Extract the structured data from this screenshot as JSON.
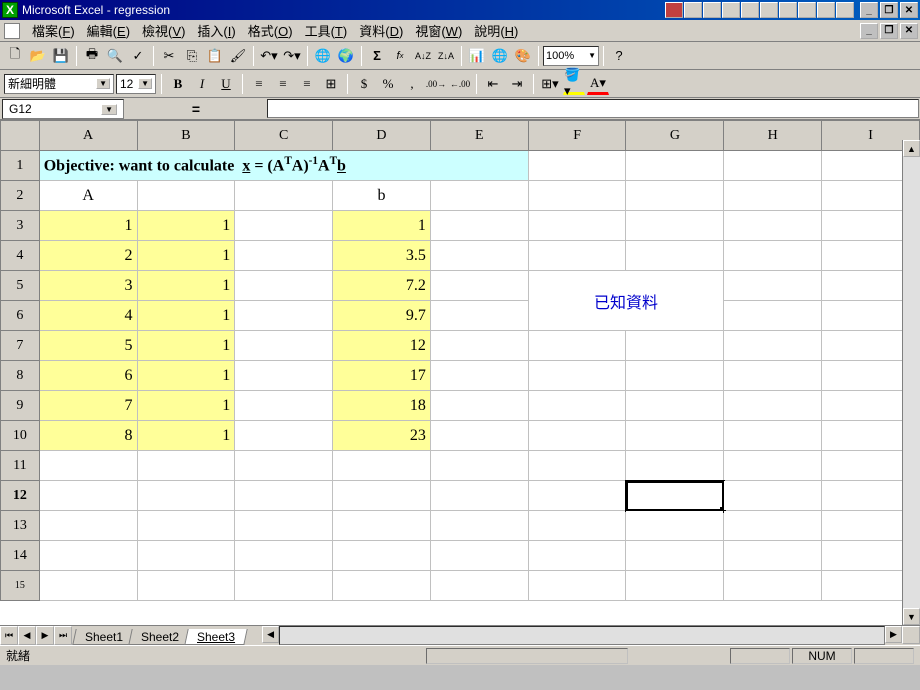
{
  "titlebar": {
    "app_name": "Microsoft Excel",
    "doc_name": "regression"
  },
  "menubar": {
    "items": [
      {
        "label": "檔案",
        "key": "F"
      },
      {
        "label": "編輯",
        "key": "E"
      },
      {
        "label": "檢視",
        "key": "V"
      },
      {
        "label": "插入",
        "key": "I"
      },
      {
        "label": "格式",
        "key": "O"
      },
      {
        "label": "工具",
        "key": "T"
      },
      {
        "label": "資料",
        "key": "D"
      },
      {
        "label": "視窗",
        "key": "W"
      },
      {
        "label": "說明",
        "key": "H"
      }
    ]
  },
  "toolbar": {
    "zoom": "100%"
  },
  "format": {
    "font_name": "新細明體",
    "font_size": "12"
  },
  "name_box": {
    "cell_ref": "G12",
    "formula_label": "="
  },
  "columns": [
    "A",
    "B",
    "C",
    "D",
    "E",
    "F",
    "G",
    "H",
    "I"
  ],
  "rows": [
    "1",
    "2",
    "3",
    "4",
    "5",
    "6",
    "7",
    "8",
    "9",
    "10",
    "11",
    "12",
    "13",
    "14",
    "15"
  ],
  "content": {
    "objective": "Objective: want to calculate",
    "header_A": "A",
    "header_b": "b",
    "known_label": "已知資料",
    "matA_col1": [
      "1",
      "2",
      "3",
      "4",
      "5",
      "6",
      "7",
      "8"
    ],
    "matA_col2": [
      "1",
      "1",
      "1",
      "1",
      "1",
      "1",
      "1",
      "1"
    ],
    "vec_b": [
      "1",
      "3.5",
      "7.2",
      "9.7",
      "12",
      "17",
      "18",
      "23"
    ]
  },
  "sheet_tabs": [
    "Sheet1",
    "Sheet2",
    "Sheet3"
  ],
  "active_sheet": 2,
  "status": {
    "ready": "就緒",
    "num": "NUM"
  }
}
